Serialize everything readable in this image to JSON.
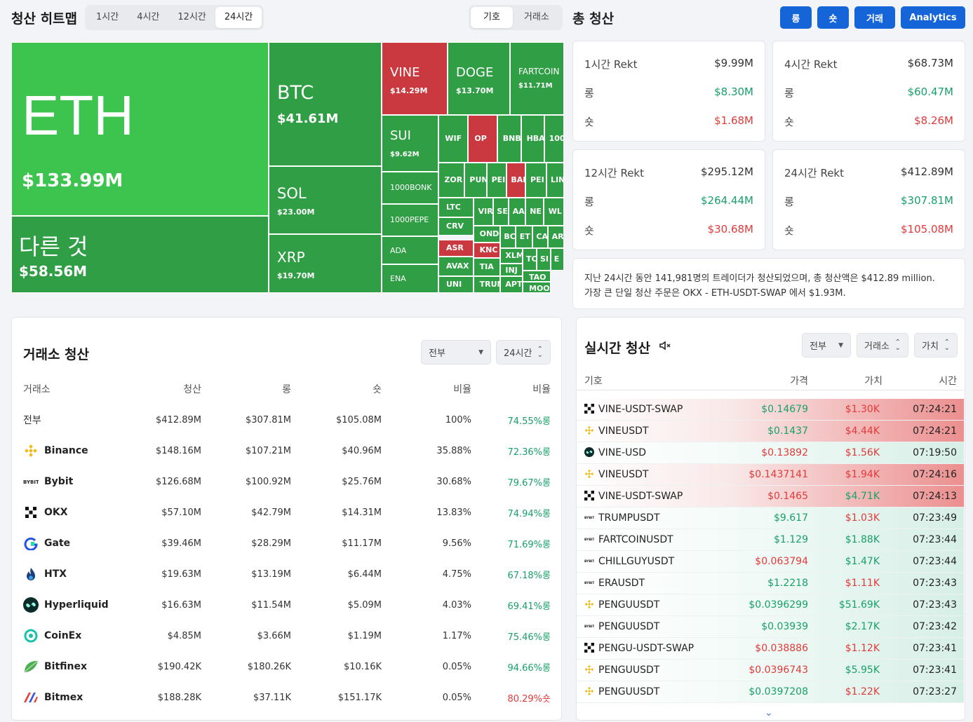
{
  "heatmap": {
    "title": "청산 히트맵",
    "time_tabs": [
      "1시간",
      "4시간",
      "12시간",
      "24시간"
    ],
    "active_tab": "24시간",
    "view_tabs": [
      "기호",
      "거래소"
    ],
    "tiles": [
      {
        "sym": "ETH",
        "val": "$133.99M"
      },
      {
        "sym": "다른 것",
        "val": "$58.56M"
      },
      {
        "sym": "BTC",
        "val": "$41.61M"
      },
      {
        "sym": "SOL",
        "val": "$23.00M"
      },
      {
        "sym": "XRP",
        "val": "$19.70M"
      },
      {
        "sym": "VINE",
        "val": "$14.29M"
      },
      {
        "sym": "DOGE",
        "val": "$13.70M"
      },
      {
        "sym": "FARTCOIN",
        "val": "$11.71M"
      },
      {
        "sym": "SUI",
        "val": "$9.62M"
      },
      {
        "sym": "1000BONK",
        "val": ""
      },
      {
        "sym": "1000PEPE",
        "val": ""
      },
      {
        "sym": "ADA",
        "val": ""
      },
      {
        "sym": "ENA",
        "val": ""
      },
      {
        "sym": "WIF",
        "val": ""
      },
      {
        "sym": "OP",
        "val": ""
      },
      {
        "sym": "BNB",
        "val": ""
      },
      {
        "sym": "HBA",
        "val": ""
      },
      {
        "sym": "100",
        "val": ""
      },
      {
        "sym": "ZOR",
        "val": ""
      },
      {
        "sym": "PUN",
        "val": ""
      },
      {
        "sym": "PEI",
        "val": ""
      },
      {
        "sym": "BAI",
        "val": ""
      },
      {
        "sym": "PEI",
        "val": ""
      },
      {
        "sym": "LIN",
        "val": ""
      },
      {
        "sym": "LTC",
        "val": ""
      },
      {
        "sym": "CRV",
        "val": ""
      },
      {
        "sym": "ASR",
        "val": ""
      },
      {
        "sym": "AVAX",
        "val": ""
      },
      {
        "sym": "UNI",
        "val": ""
      },
      {
        "sym": "VIR",
        "val": ""
      },
      {
        "sym": "SEI",
        "val": ""
      },
      {
        "sym": "AA",
        "val": ""
      },
      {
        "sym": "NE",
        "val": ""
      },
      {
        "sym": "WL",
        "val": ""
      },
      {
        "sym": "ONDO",
        "val": ""
      },
      {
        "sym": "BC",
        "val": ""
      },
      {
        "sym": "ET",
        "val": ""
      },
      {
        "sym": "CA",
        "val": ""
      },
      {
        "sym": "AR",
        "val": ""
      },
      {
        "sym": "KNC",
        "val": ""
      },
      {
        "sym": "XLM",
        "val": ""
      },
      {
        "sym": "TC",
        "val": ""
      },
      {
        "sym": "SI",
        "val": ""
      },
      {
        "sym": "E",
        "val": ""
      },
      {
        "sym": "TIA",
        "val": ""
      },
      {
        "sym": "INJ",
        "val": ""
      },
      {
        "sym": "TAO",
        "val": ""
      },
      {
        "sym": "TRUN",
        "val": ""
      },
      {
        "sym": "APT",
        "val": ""
      },
      {
        "sym": "MOO",
        "val": ""
      },
      {
        "sym": "SI",
        "val": ""
      }
    ]
  },
  "total": {
    "title": "총 청산",
    "buttons": [
      "롱",
      "숏",
      "거래",
      "Analytics"
    ],
    "cards": [
      {
        "label": "1시간 Rekt",
        "total": "$9.99M",
        "long_label": "롱",
        "long": "$8.30M",
        "short_label": "숏",
        "short": "$1.68M"
      },
      {
        "label": "4시간 Rekt",
        "total": "$68.73M",
        "long_label": "롱",
        "long": "$60.47M",
        "short_label": "숏",
        "short": "$8.26M"
      },
      {
        "label": "12시간 Rekt",
        "total": "$295.12M",
        "long_label": "롱",
        "long": "$264.44M",
        "short_label": "숏",
        "short": "$30.68M"
      },
      {
        "label": "24시간 Rekt",
        "total": "$412.89M",
        "long_label": "롱",
        "long": "$307.81M",
        "short_label": "숏",
        "short": "$105.08M"
      }
    ],
    "summary_line1": "지난 24시간 동안 141,981명의 트레이더가 청산되었으며, 총 청산액은 $412.89 million.",
    "summary_line2": "가장 큰 단일 청산 주문은 OKX - ETH-USDT-SWAP 에서 $1.93M."
  },
  "exchange": {
    "title": "거래소 청산",
    "filter": "전부",
    "period": "24시간",
    "headers": [
      "거래소",
      "청산",
      "롱",
      "숏",
      "비율",
      "비율"
    ],
    "rows": [
      {
        "name": "전부",
        "icon": "",
        "liq": "$412.89M",
        "long": "$307.81M",
        "short": "$105.08M",
        "ratio": "100%",
        "side": "74.55%롱",
        "side_color": "#18a06a"
      },
      {
        "name": "Binance",
        "icon": "binance-icon",
        "liq": "$148.16M",
        "long": "$107.21M",
        "short": "$40.96M",
        "ratio": "35.88%",
        "side": "72.36%롱",
        "side_color": "#18a06a"
      },
      {
        "name": "Bybit",
        "icon": "bybit-icon",
        "liq": "$126.68M",
        "long": "$100.92M",
        "short": "$25.76M",
        "ratio": "30.68%",
        "side": "79.67%롱",
        "side_color": "#18a06a"
      },
      {
        "name": "OKX",
        "icon": "okx-icon",
        "liq": "$57.10M",
        "long": "$42.79M",
        "short": "$14.31M",
        "ratio": "13.83%",
        "side": "74.94%롱",
        "side_color": "#18a06a"
      },
      {
        "name": "Gate",
        "icon": "gate-icon",
        "liq": "$39.46M",
        "long": "$28.29M",
        "short": "$11.17M",
        "ratio": "9.56%",
        "side": "71.69%롱",
        "side_color": "#18a06a"
      },
      {
        "name": "HTX",
        "icon": "htx-icon",
        "liq": "$19.63M",
        "long": "$13.19M",
        "short": "$6.44M",
        "ratio": "4.75%",
        "side": "67.18%롱",
        "side_color": "#18a06a"
      },
      {
        "name": "Hyperliquid",
        "icon": "hyperliquid-icon",
        "liq": "$16.63M",
        "long": "$11.54M",
        "short": "$5.09M",
        "ratio": "4.03%",
        "side": "69.41%롱",
        "side_color": "#18a06a"
      },
      {
        "name": "CoinEx",
        "icon": "coinex-icon",
        "liq": "$4.85M",
        "long": "$3.66M",
        "short": "$1.19M",
        "ratio": "1.17%",
        "side": "75.46%롱",
        "side_color": "#18a06a"
      },
      {
        "name": "Bitfinex",
        "icon": "bitfinex-icon",
        "liq": "$190.42K",
        "long": "$180.26K",
        "short": "$10.16K",
        "ratio": "0.05%",
        "side": "94.66%롱",
        "side_color": "#18a06a"
      },
      {
        "name": "Bitmex",
        "icon": "bitmex-icon",
        "liq": "$188.28K",
        "long": "$37.11K",
        "short": "$151.17K",
        "ratio": "0.05%",
        "side": "80.29%숏",
        "side_color": "#e23a3a"
      }
    ]
  },
  "realtime": {
    "title": "실시간 청산",
    "filters": [
      "전부",
      "거래소",
      "가치"
    ],
    "headers": [
      "기호",
      "가격",
      "가치",
      "시간"
    ],
    "rows": [
      {
        "icon": "okx-icon",
        "sym": "VINE-USDT-SWAP",
        "price": "$0.14679",
        "price_color": "#18a06a",
        "value": "$1.30K",
        "value_color": "#e23a3a",
        "time": "07:24:21",
        "side": "short"
      },
      {
        "icon": "binance-icon",
        "sym": "VINEUSDT",
        "price": "$0.1437",
        "price_color": "#18a06a",
        "value": "$4.44K",
        "value_color": "#e23a3a",
        "time": "07:24:21",
        "side": "short"
      },
      {
        "icon": "hyperliquid-icon",
        "sym": "VINE-USD",
        "price": "$0.13892",
        "price_color": "#e23a3a",
        "value": "$1.56K",
        "value_color": "#e23a3a",
        "time": "07:19:50",
        "side": "long"
      },
      {
        "icon": "binance-icon",
        "sym": "VINEUSDT",
        "price": "$0.1437141",
        "price_color": "#e23a3a",
        "value": "$1.94K",
        "value_color": "#e23a3a",
        "time": "07:24:16",
        "side": "short"
      },
      {
        "icon": "okx-icon",
        "sym": "VINE-USDT-SWAP",
        "price": "$0.1465",
        "price_color": "#e23a3a",
        "value": "$4.71K",
        "value_color": "#18a06a",
        "time": "07:24:13",
        "side": "short"
      },
      {
        "icon": "bybit-icon",
        "sym": "TRUMPUSDT",
        "price": "$9.617",
        "price_color": "#18a06a",
        "value": "$1.03K",
        "value_color": "#e23a3a",
        "time": "07:23:49",
        "side": "long"
      },
      {
        "icon": "bybit-icon",
        "sym": "FARTCOINUSDT",
        "price": "$1.129",
        "price_color": "#18a06a",
        "value": "$1.88K",
        "value_color": "#18a06a",
        "time": "07:23:44",
        "side": "long"
      },
      {
        "icon": "bybit-icon",
        "sym": "CHILLGUYUSDT",
        "price": "$0.063794",
        "price_color": "#e23a3a",
        "value": "$1.47K",
        "value_color": "#18a06a",
        "time": "07:23:44",
        "side": "long"
      },
      {
        "icon": "bybit-icon",
        "sym": "ERAUSDT",
        "price": "$1.2218",
        "price_color": "#18a06a",
        "value": "$1.11K",
        "value_color": "#e23a3a",
        "time": "07:23:43",
        "side": "long"
      },
      {
        "icon": "binance-icon",
        "sym": "PENGUUSDT",
        "price": "$0.0396299",
        "price_color": "#18a06a",
        "value": "$51.69K",
        "value_color": "#18a06a",
        "time": "07:23:43",
        "side": "long"
      },
      {
        "icon": "bybit-icon",
        "sym": "PENGUUSDT",
        "price": "$0.03939",
        "price_color": "#18a06a",
        "value": "$2.17K",
        "value_color": "#18a06a",
        "time": "07:23:42",
        "side": "long"
      },
      {
        "icon": "okx-icon",
        "sym": "PENGU-USDT-SWAP",
        "price": "$0.038886",
        "price_color": "#e23a3a",
        "value": "$1.12K",
        "value_color": "#e23a3a",
        "time": "07:23:41",
        "side": "long"
      },
      {
        "icon": "binance-icon",
        "sym": "PENGUUSDT",
        "price": "$0.0396743",
        "price_color": "#e23a3a",
        "value": "$5.95K",
        "value_color": "#18a06a",
        "time": "07:23:41",
        "side": "long"
      },
      {
        "icon": "binance-icon",
        "sym": "PENGUUSDT",
        "price": "$0.0397208",
        "price_color": "#18a06a",
        "value": "$1.22K",
        "value_color": "#e23a3a",
        "time": "07:23:27",
        "side": "long"
      }
    ]
  }
}
